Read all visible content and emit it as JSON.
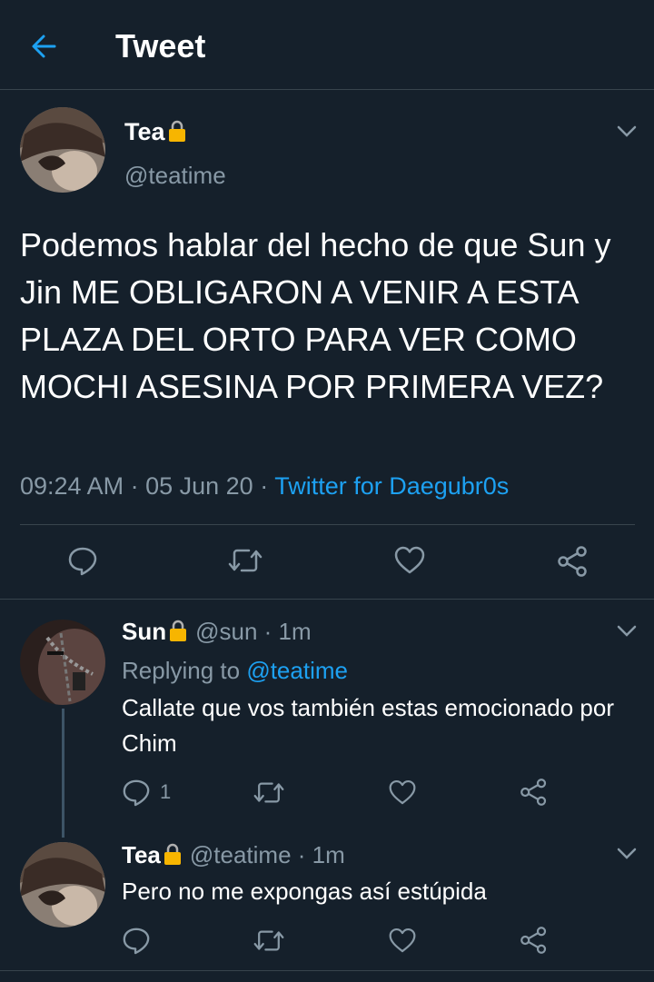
{
  "header": {
    "title": "Tweet",
    "back_icon": "arrow-left-icon"
  },
  "colors": {
    "background": "#15202b",
    "accent": "#1da1f2",
    "muted": "#8899a6",
    "divider": "#38444d"
  },
  "main_tweet": {
    "name": "Tea",
    "handle": "@teatime",
    "text": "Podemos hablar del hecho de que Sun y Jin ME OBLIGARON A VENIR A ESTA PLAZA DEL ORTO PARA VER COMO MOCHI ASESINA POR PRIMERA VEZ?",
    "time": "09:24 AM",
    "sep1": " · ",
    "date": "05 Jun 20",
    "sep2": " · ",
    "source": "Twitter for Daegubr0s"
  },
  "replies": [
    {
      "name": "Sun",
      "handle": "@sun",
      "age": " · 1m",
      "replying_label": "Replying to ",
      "replying_to": "@teatime",
      "text": "Callate que vos también estas emocionado por Chim",
      "reply_count": "1"
    },
    {
      "name": "Tea",
      "handle": "@teatime",
      "age": " · 1m",
      "text": "Pero no me expongas así estúpida"
    }
  ]
}
